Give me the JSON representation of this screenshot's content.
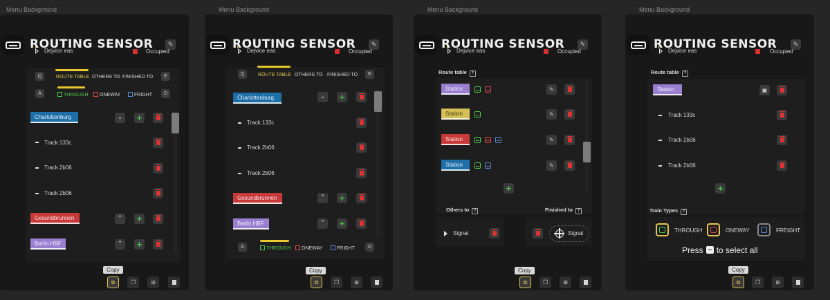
{
  "frame_label": "Menu Background",
  "title": "ROUTING SENSOR",
  "sensor": {
    "name": "Dejvice eas",
    "status": "Occupied"
  },
  "tabs": {
    "left_key": "Q",
    "right_key": "E",
    "route_table": "ROUTE TABLE",
    "others_to": "OTHERS TO",
    "finished_to": "FINISHED TO"
  },
  "filters": {
    "left_key": "A",
    "right_key": "D",
    "through": "THROUGH",
    "oneway": "ONEWAY",
    "fright": "FRIGHT"
  },
  "stations": {
    "charlottenburg": "Charlottenburg",
    "gesundbrunnen": "Gesundbrunnen",
    "berlin_hbf": "Berlin HBF",
    "station": "Station"
  },
  "tracks": {
    "t1": "Track 133c",
    "t2": "Track 2b06",
    "t3": "Track 2b06"
  },
  "sections": {
    "route_table": "Route table",
    "others_to": "Others to",
    "finished_to": "Finished to",
    "train_types": "Train Types"
  },
  "others_target": "Signal",
  "finished_target": "Signal",
  "train_types": {
    "through": "THROUGH",
    "oneway": "ONEWAY",
    "freight": "FREIGHT"
  },
  "select_all": {
    "press": "Press",
    "rest": "to select all"
  },
  "tooltip": "Copy",
  "colors": {
    "yellow": "#e6c64e",
    "red": "#d83030",
    "green": "#4ec84e",
    "blue": "#5a8ad8",
    "purple": "#9a7fd1",
    "station_blue": "#1e6fa8"
  }
}
